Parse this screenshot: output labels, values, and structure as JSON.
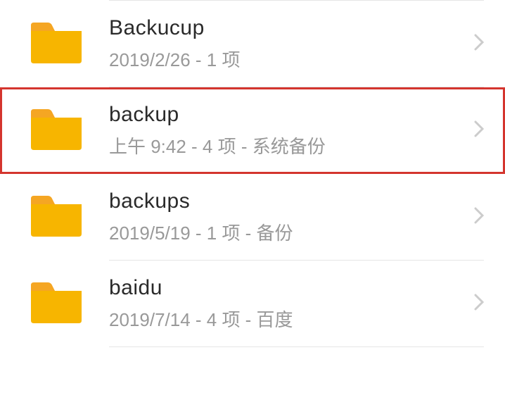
{
  "folders": [
    {
      "name": "Backucup",
      "meta": "2019/2/26 - 1 项",
      "highlighted": false
    },
    {
      "name": "backup",
      "meta": "上午 9:42 - 4 项 - 系统备份",
      "highlighted": true
    },
    {
      "name": "backups",
      "meta": "2019/5/19 - 1 项 - 备份",
      "highlighted": false
    },
    {
      "name": "baidu",
      "meta": "2019/7/14 - 4 项 - 百度",
      "highlighted": false
    }
  ],
  "colors": {
    "folderMain": "#f7b500",
    "folderTab": "#f5a623",
    "highlightBorder": "#d4352e",
    "textPrimary": "#2a2a2a",
    "textSecondary": "#999999"
  }
}
